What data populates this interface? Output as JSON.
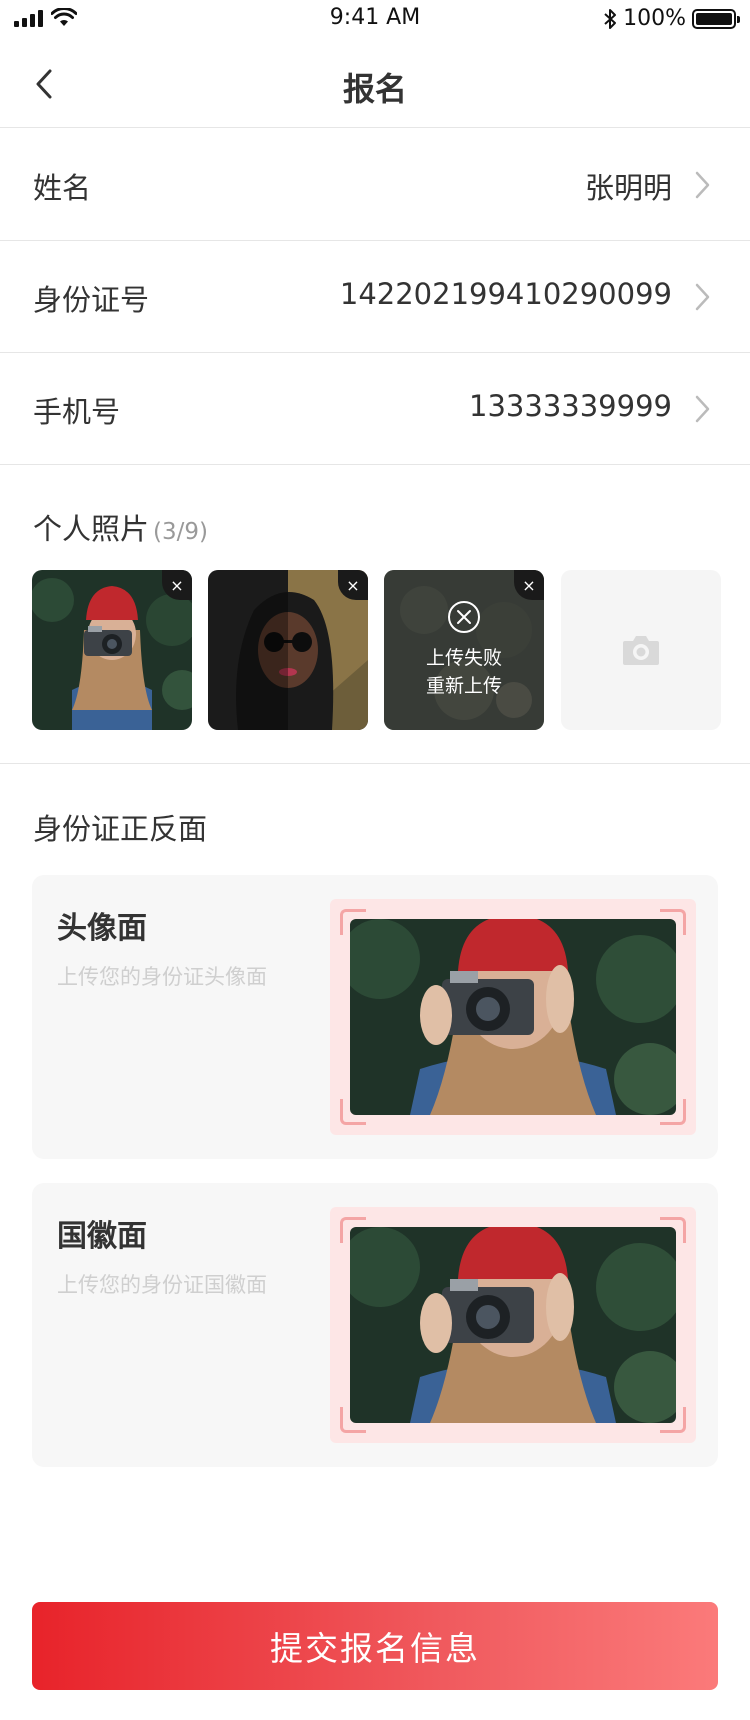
{
  "status_bar": {
    "time": "9:41 AM",
    "battery": "100%",
    "battery_level": 1.0
  },
  "nav": {
    "title": "报名"
  },
  "form": {
    "name_label": "姓名",
    "name_value": "张明明",
    "id_label": "身份证号",
    "id_value": "142202199410290099",
    "phone_label": "手机号",
    "phone_value": "13333339999"
  },
  "photos": {
    "title": "个人照片",
    "count": "(3/9)",
    "fail_line1": "上传失败",
    "fail_line2": "重新上传",
    "close_icon": "×"
  },
  "id_section": {
    "title": "身份证正反面",
    "front_title": "头像面",
    "front_sub": "上传您的身份证头像面",
    "back_title": "国徽面",
    "back_sub": "上传您的身份证国徽面"
  },
  "submit": {
    "label": "提交报名信息"
  },
  "colors": {
    "accent": "#e8232a",
    "accent_light": "#fb7a7a",
    "frame_bg": "#fde6e6",
    "corner": "#f4a5a5"
  }
}
